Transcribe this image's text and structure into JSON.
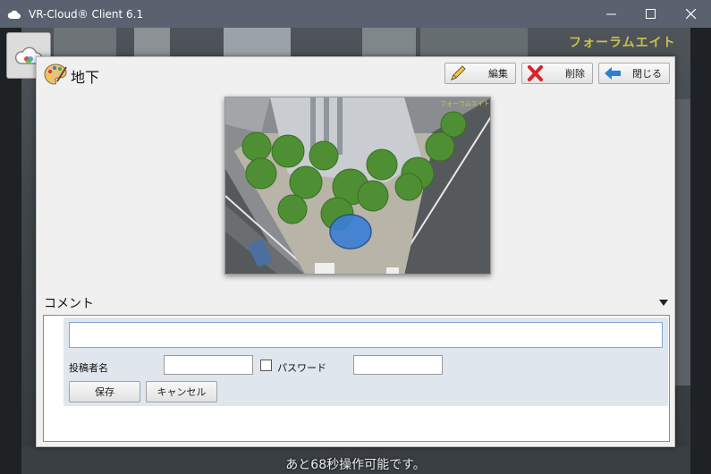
{
  "window": {
    "title": "VR-Cloud® Client 6.1"
  },
  "scene": {
    "brand_text": "フォーラムエイト",
    "status_text": "あと68秒操作可能です。"
  },
  "dialog": {
    "title": "地下",
    "buttons": {
      "edit": "編集",
      "delete": "削除",
      "close": "閉じる"
    },
    "photo_brand_text": "フォーラムエイト",
    "comment": {
      "section_label": "コメント",
      "input_value": "",
      "poster_label": "投稿者名",
      "poster_value": "",
      "password_label": "パスワード",
      "password_checked": false,
      "password_value": "",
      "save_label": "保存",
      "cancel_label": "キャンセル"
    }
  },
  "icons": {
    "app": "cloud-icon",
    "edit": "pencil-icon",
    "delete": "red-x-icon",
    "close": "blue-arrow-left-icon",
    "dialog": "palette-icon",
    "collapse": "triangle-down-icon"
  },
  "colors": {
    "titlebar": "#5a6270",
    "form_area": "#dfe6ee",
    "input_focus_border": "#7fa7d6",
    "delete_red": "#d8242a",
    "close_blue": "#2d7fd3"
  }
}
